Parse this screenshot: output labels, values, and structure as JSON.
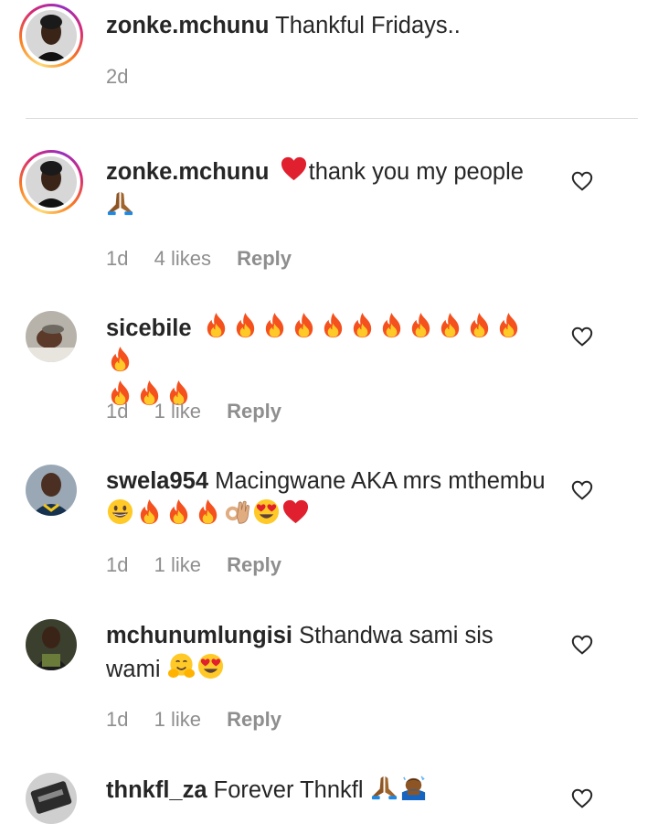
{
  "caption": {
    "username": "zonke.mchunu",
    "text": "Thankful Fridays..",
    "time": "2d"
  },
  "comments": [
    {
      "username": "zonke.mchunu",
      "text": "thank you my people",
      "emojis_before": [
        "red-heart-emoji"
      ],
      "emojis_after": [
        "folded-hands-emoji"
      ],
      "time": "1d",
      "likes": "4 likes",
      "reply": "Reply"
    },
    {
      "username": "sicebile",
      "text": "",
      "emojis_after": [
        "fire-emoji x15"
      ],
      "time": "1d",
      "likes": "1 like",
      "reply": "Reply"
    },
    {
      "username": "swela954",
      "text": "Macingwane AKA mrs mthembu",
      "emojis_after": [
        "grinning-face-emoji",
        "fire-emoji",
        "fire-emoji",
        "fire-emoji",
        "ok-hand-emoji",
        "heart-eyes-emoji",
        "red-heart-emoji"
      ],
      "time": "1d",
      "likes": "1 like",
      "reply": "Reply"
    },
    {
      "username": "mchunumlungisi",
      "text": "Sthandwa sami sis wami",
      "emojis_after": [
        "hugging-face-emoji",
        "heart-eyes-emoji"
      ],
      "time": "1d",
      "likes": "1 like",
      "reply": "Reply"
    },
    {
      "username": "thnkfl_za",
      "text": "Forever Thnkfl",
      "emojis_after": [
        "folded-hands-emoji",
        "person-bowing-emoji"
      ],
      "time": "",
      "likes": "",
      "reply": ""
    }
  ],
  "icons": {
    "like": "heart-outline-icon"
  },
  "colors": {
    "text": "#262626",
    "secondary": "#8e8e8e",
    "divider": "#dbdbdb",
    "heart_emoji": "#e0202e",
    "fire_outer": "#f4511e",
    "fire_inner": "#ffca28"
  }
}
